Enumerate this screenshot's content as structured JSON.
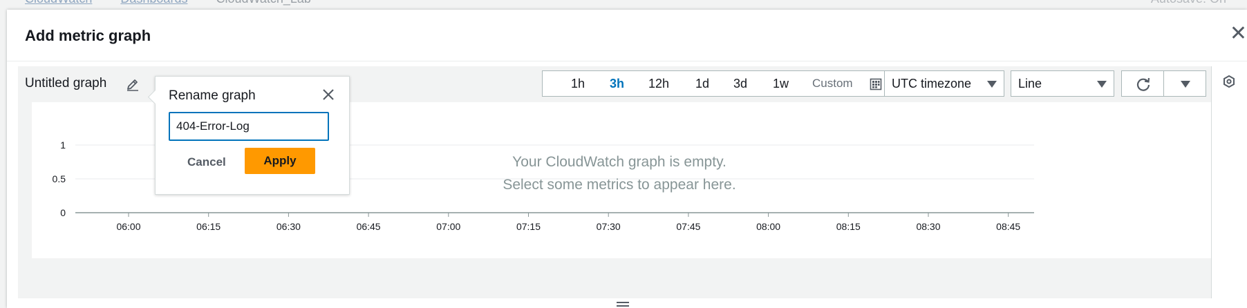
{
  "background": {
    "breadcrumbs": [
      "CloudWatch",
      "Dashboards",
      "CloudWatch_Lab"
    ],
    "autosave": "Autosave: On"
  },
  "modal": {
    "title": "Add metric graph"
  },
  "graph": {
    "title": "Untitled graph",
    "time_ranges": [
      "1h",
      "3h",
      "12h",
      "1d",
      "3d",
      "1w"
    ],
    "active_range": "3h",
    "custom_label": "Custom",
    "timezone": "UTC timezone",
    "chart_type": "Line",
    "empty_line1": "Your CloudWatch graph is empty.",
    "empty_line2": "Select some metrics to appear here."
  },
  "rename_popover": {
    "title": "Rename graph",
    "input_value": "404-Error-Log",
    "cancel_label": "Cancel",
    "apply_label": "Apply"
  },
  "chart_data": {
    "type": "line",
    "title": "",
    "x": [
      "06:00",
      "06:15",
      "06:30",
      "06:45",
      "07:00",
      "07:15",
      "07:30",
      "07:45",
      "08:00",
      "08:15",
      "08:30",
      "08:45"
    ],
    "yticks": [
      "0",
      "0.5",
      "1"
    ],
    "ylim": [
      0,
      1
    ],
    "series": [],
    "grid": true
  },
  "colors": {
    "accent": "#0073bb",
    "apply": "#ff9900"
  }
}
